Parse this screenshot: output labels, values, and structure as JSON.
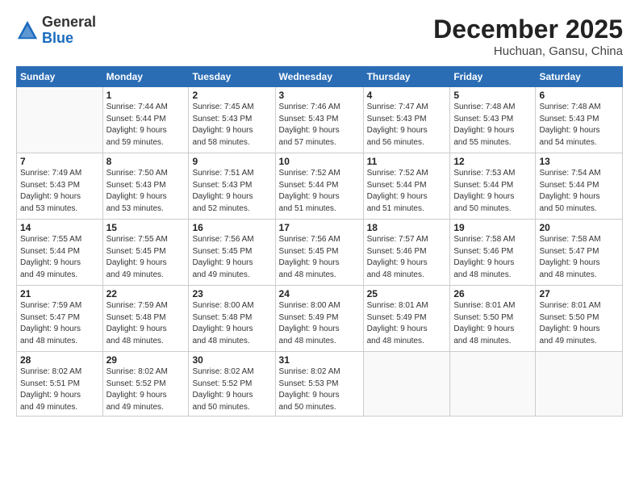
{
  "header": {
    "logo_general": "General",
    "logo_blue": "Blue",
    "month_title": "December 2025",
    "location": "Huchuan, Gansu, China"
  },
  "calendar": {
    "days_of_week": [
      "Sunday",
      "Monday",
      "Tuesday",
      "Wednesday",
      "Thursday",
      "Friday",
      "Saturday"
    ],
    "weeks": [
      [
        {
          "day": "",
          "info": ""
        },
        {
          "day": "1",
          "info": "Sunrise: 7:44 AM\nSunset: 5:44 PM\nDaylight: 9 hours\nand 59 minutes."
        },
        {
          "day": "2",
          "info": "Sunrise: 7:45 AM\nSunset: 5:43 PM\nDaylight: 9 hours\nand 58 minutes."
        },
        {
          "day": "3",
          "info": "Sunrise: 7:46 AM\nSunset: 5:43 PM\nDaylight: 9 hours\nand 57 minutes."
        },
        {
          "day": "4",
          "info": "Sunrise: 7:47 AM\nSunset: 5:43 PM\nDaylight: 9 hours\nand 56 minutes."
        },
        {
          "day": "5",
          "info": "Sunrise: 7:48 AM\nSunset: 5:43 PM\nDaylight: 9 hours\nand 55 minutes."
        },
        {
          "day": "6",
          "info": "Sunrise: 7:48 AM\nSunset: 5:43 PM\nDaylight: 9 hours\nand 54 minutes."
        }
      ],
      [
        {
          "day": "7",
          "info": "Sunrise: 7:49 AM\nSunset: 5:43 PM\nDaylight: 9 hours\nand 53 minutes."
        },
        {
          "day": "8",
          "info": "Sunrise: 7:50 AM\nSunset: 5:43 PM\nDaylight: 9 hours\nand 53 minutes."
        },
        {
          "day": "9",
          "info": "Sunrise: 7:51 AM\nSunset: 5:43 PM\nDaylight: 9 hours\nand 52 minutes."
        },
        {
          "day": "10",
          "info": "Sunrise: 7:52 AM\nSunset: 5:44 PM\nDaylight: 9 hours\nand 51 minutes."
        },
        {
          "day": "11",
          "info": "Sunrise: 7:52 AM\nSunset: 5:44 PM\nDaylight: 9 hours\nand 51 minutes."
        },
        {
          "day": "12",
          "info": "Sunrise: 7:53 AM\nSunset: 5:44 PM\nDaylight: 9 hours\nand 50 minutes."
        },
        {
          "day": "13",
          "info": "Sunrise: 7:54 AM\nSunset: 5:44 PM\nDaylight: 9 hours\nand 50 minutes."
        }
      ],
      [
        {
          "day": "14",
          "info": "Sunrise: 7:55 AM\nSunset: 5:44 PM\nDaylight: 9 hours\nand 49 minutes."
        },
        {
          "day": "15",
          "info": "Sunrise: 7:55 AM\nSunset: 5:45 PM\nDaylight: 9 hours\nand 49 minutes."
        },
        {
          "day": "16",
          "info": "Sunrise: 7:56 AM\nSunset: 5:45 PM\nDaylight: 9 hours\nand 49 minutes."
        },
        {
          "day": "17",
          "info": "Sunrise: 7:56 AM\nSunset: 5:45 PM\nDaylight: 9 hours\nand 48 minutes."
        },
        {
          "day": "18",
          "info": "Sunrise: 7:57 AM\nSunset: 5:46 PM\nDaylight: 9 hours\nand 48 minutes."
        },
        {
          "day": "19",
          "info": "Sunrise: 7:58 AM\nSunset: 5:46 PM\nDaylight: 9 hours\nand 48 minutes."
        },
        {
          "day": "20",
          "info": "Sunrise: 7:58 AM\nSunset: 5:47 PM\nDaylight: 9 hours\nand 48 minutes."
        }
      ],
      [
        {
          "day": "21",
          "info": "Sunrise: 7:59 AM\nSunset: 5:47 PM\nDaylight: 9 hours\nand 48 minutes."
        },
        {
          "day": "22",
          "info": "Sunrise: 7:59 AM\nSunset: 5:48 PM\nDaylight: 9 hours\nand 48 minutes."
        },
        {
          "day": "23",
          "info": "Sunrise: 8:00 AM\nSunset: 5:48 PM\nDaylight: 9 hours\nand 48 minutes."
        },
        {
          "day": "24",
          "info": "Sunrise: 8:00 AM\nSunset: 5:49 PM\nDaylight: 9 hours\nand 48 minutes."
        },
        {
          "day": "25",
          "info": "Sunrise: 8:01 AM\nSunset: 5:49 PM\nDaylight: 9 hours\nand 48 minutes."
        },
        {
          "day": "26",
          "info": "Sunrise: 8:01 AM\nSunset: 5:50 PM\nDaylight: 9 hours\nand 48 minutes."
        },
        {
          "day": "27",
          "info": "Sunrise: 8:01 AM\nSunset: 5:50 PM\nDaylight: 9 hours\nand 49 minutes."
        }
      ],
      [
        {
          "day": "28",
          "info": "Sunrise: 8:02 AM\nSunset: 5:51 PM\nDaylight: 9 hours\nand 49 minutes."
        },
        {
          "day": "29",
          "info": "Sunrise: 8:02 AM\nSunset: 5:52 PM\nDaylight: 9 hours\nand 49 minutes."
        },
        {
          "day": "30",
          "info": "Sunrise: 8:02 AM\nSunset: 5:52 PM\nDaylight: 9 hours\nand 50 minutes."
        },
        {
          "day": "31",
          "info": "Sunrise: 8:02 AM\nSunset: 5:53 PM\nDaylight: 9 hours\nand 50 minutes."
        },
        {
          "day": "",
          "info": ""
        },
        {
          "day": "",
          "info": ""
        },
        {
          "day": "",
          "info": ""
        }
      ]
    ]
  }
}
